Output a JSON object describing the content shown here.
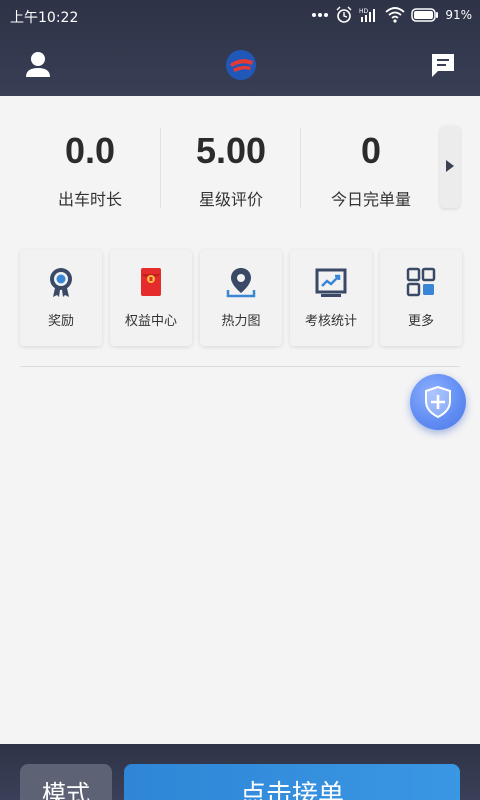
{
  "status_bar": {
    "time": "上午10:22",
    "battery": "91%"
  },
  "header": {
    "icons": [
      "user-icon",
      "app-logo",
      "message-icon"
    ]
  },
  "stats": [
    {
      "value": "0.0",
      "label": "出车时长"
    },
    {
      "value": "5.00",
      "label": "星级评价"
    },
    {
      "value": "0",
      "label": "今日完单量"
    }
  ],
  "quick_actions": [
    {
      "label": "奖励",
      "icon": "reward-medal-icon"
    },
    {
      "label": "权益中心",
      "icon": "red-envelope-icon"
    },
    {
      "label": "热力图",
      "icon": "map-pin-icon"
    },
    {
      "label": "考核统计",
      "icon": "stats-chart-icon"
    },
    {
      "label": "更多",
      "icon": "grid-more-icon"
    }
  ],
  "bottom": {
    "mode_label": "模式",
    "accept_label": "点击接单"
  },
  "colors": {
    "header_bg": "#2e3347",
    "accent_blue": "#3a97e4",
    "fab_blue": "#5f8bf2"
  }
}
